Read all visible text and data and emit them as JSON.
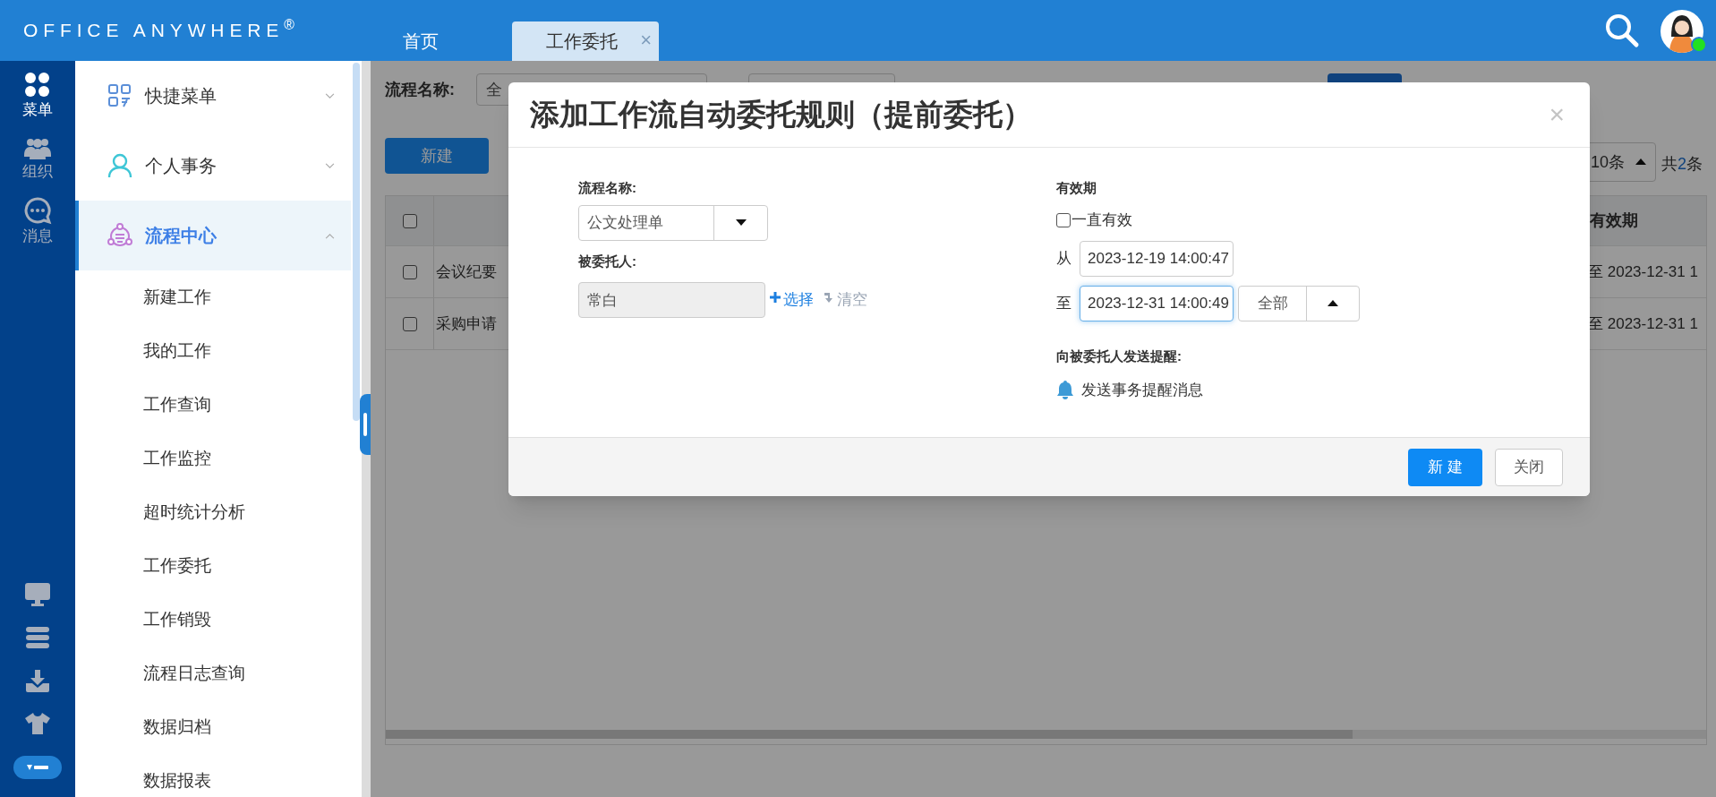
{
  "header": {
    "logo": "OFFICE ANYWHERE$^{®}$",
    "tabs": [
      {
        "label": "首页",
        "selected": false
      },
      {
        "label": "工作委托",
        "selected": true,
        "close": "×"
      }
    ],
    "avatar": {
      "online": true
    }
  },
  "rail": {
    "items": [
      {
        "label": "菜单",
        "kind": "apps",
        "selected": true
      },
      {
        "label": "组织",
        "kind": "people",
        "selected": false
      },
      {
        "label": "消息",
        "kind": "chat",
        "selected": false
      }
    ]
  },
  "menu": {
    "sections": [
      {
        "label": "快捷菜单",
        "kind": "grid",
        "expanded": false,
        "selected": false
      },
      {
        "label": "个人事务",
        "kind": "person",
        "expanded": false,
        "selected": false
      },
      {
        "label": "流程中心",
        "kind": "flow",
        "expanded": true,
        "selected": true,
        "children": [
          {
            "label": "新建工作"
          },
          {
            "label": "我的工作"
          },
          {
            "label": "工作查询"
          },
          {
            "label": "工作监控"
          },
          {
            "label": "超时统计分析"
          },
          {
            "label": "工作委托"
          },
          {
            "label": "工作销毁"
          },
          {
            "label": "流程日志查询"
          },
          {
            "label": "数据归档"
          },
          {
            "label": "数据报表"
          }
        ]
      }
    ]
  },
  "page": {
    "filter": {
      "label": "流程名称:",
      "select_value": "全"
    },
    "new_button": "新建",
    "pager": {
      "page_size": "10条",
      "total_before": "共",
      "total_count": "2",
      "total_after": "条"
    },
    "table": {
      "columns": [
        {
          "kind": "check",
          "checked": false
        },
        {
          "kind": "text"
        },
        {
          "label": "有效期",
          "kind": "text"
        }
      ],
      "rows": [
        {
          "checked": false,
          "cells": [
            "会议纪要",
            "至 2023-12-31 1"
          ]
        },
        {
          "checked": false,
          "cells": [
            "采购申请",
            "至 2023-12-31 1"
          ]
        }
      ]
    }
  },
  "modal": {
    "title": "添加工作流自动委托规则（提前委托）",
    "close": "×",
    "flow": {
      "label": "流程名称:",
      "value": "公文处理单"
    },
    "assignee": {
      "label": "被委托人:",
      "value": "常白",
      "disabled": true,
      "select_link": "选择",
      "clear_link": "清空",
      "clear_disabled": true
    },
    "validity": {
      "label": "有效期",
      "always": {
        "label": "一直有效",
        "checked": false
      },
      "from": {
        "label": "从",
        "value": "2023-12-19 14:00:47",
        "focused": false
      },
      "to": {
        "label": "至",
        "value": "2023-12-31 14:00:49",
        "focused": true
      },
      "range_button": "全部"
    },
    "remind": {
      "label": "向被委托人发送提醒:",
      "option": "发送事务提醒消息"
    },
    "buttons": [
      {
        "label": "新 建",
        "kind": "primary"
      },
      {
        "label": "关闭",
        "kind": "default"
      }
    ]
  }
}
